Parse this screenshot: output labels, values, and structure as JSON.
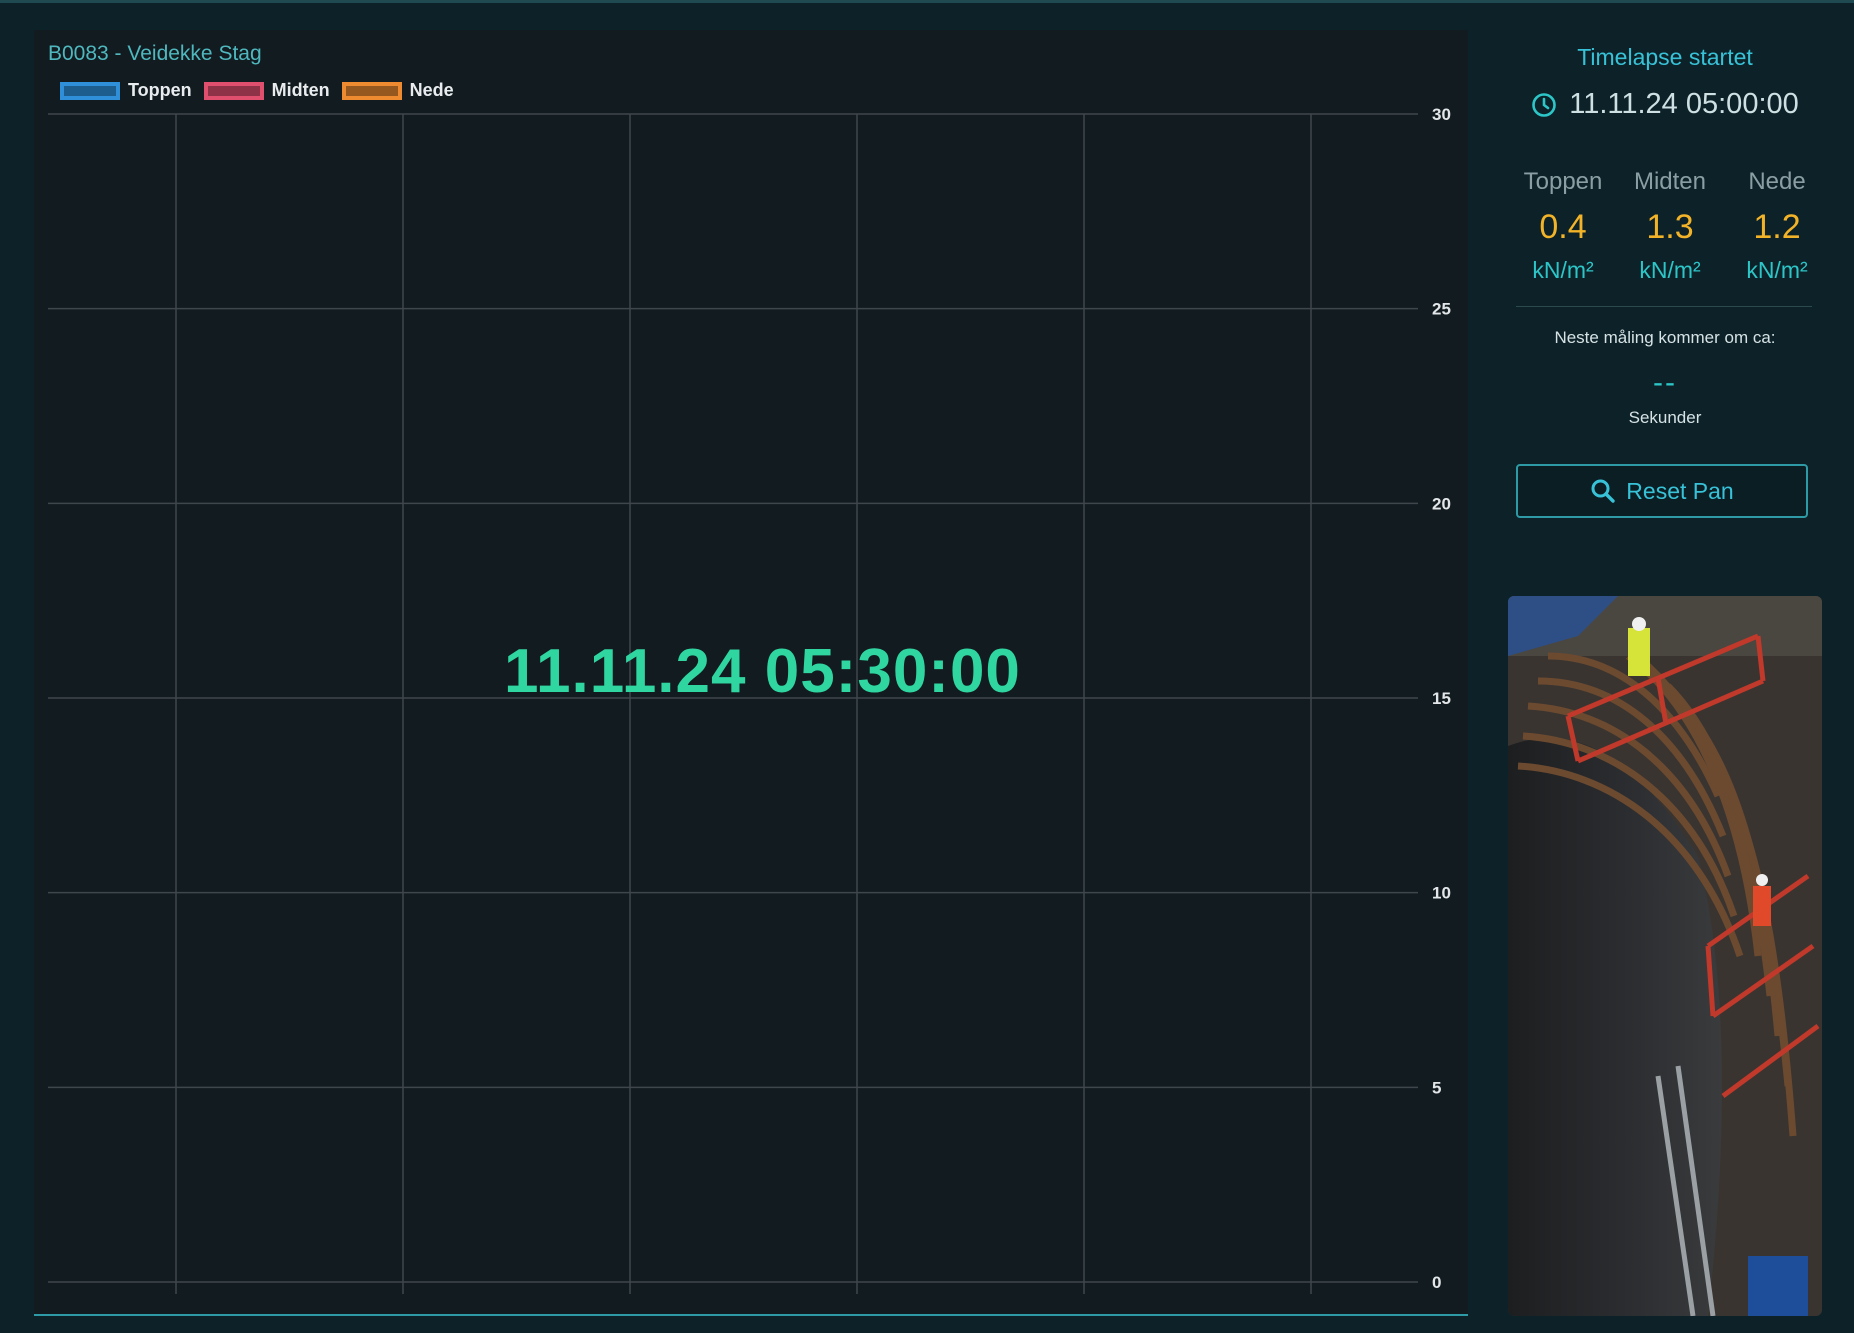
{
  "chart": {
    "title": "B0083 - Veidekke Stag",
    "overlay_time": "11.11.24 05:30:00",
    "chart_data": {
      "type": "line",
      "series": [
        {
          "name": "Toppen",
          "values": []
        },
        {
          "name": "Midten",
          "values": []
        },
        {
          "name": "Nede",
          "values": []
        }
      ],
      "ylim": [
        0,
        30
      ],
      "yticks": [
        "30",
        "25",
        "20",
        "15",
        "10",
        "5",
        "0"
      ],
      "grid": true,
      "legend_placement": "top-left",
      "y_axis_side": "right"
    }
  },
  "legend": [
    {
      "label": "Toppen",
      "color": "#2f8fd8"
    },
    {
      "label": "Midten",
      "color": "#e0506e"
    },
    {
      "label": "Nede",
      "color": "#ee8a30"
    }
  ],
  "side": {
    "timelapse_title": "Timelapse startet",
    "timelapse_time": "11.11.24 05:00:00",
    "readings": [
      {
        "name": "Toppen",
        "value": "0.4",
        "unit": "kN/m²"
      },
      {
        "name": "Midten",
        "value": "1.3",
        "unit": "kN/m²"
      },
      {
        "name": "Nede",
        "value": "1.2",
        "unit": "kN/m²"
      }
    ],
    "next_label": "Neste måling kommer om ca:",
    "next_value": "--",
    "next_unit": "Sekunder",
    "reset_label": "Reset Pan",
    "reset_icon": "search-icon",
    "clock_icon": "clock-icon"
  },
  "colors": {
    "accent": "#2dc6c8",
    "value": "#f3b329",
    "overlay": "#2fd6a0"
  }
}
